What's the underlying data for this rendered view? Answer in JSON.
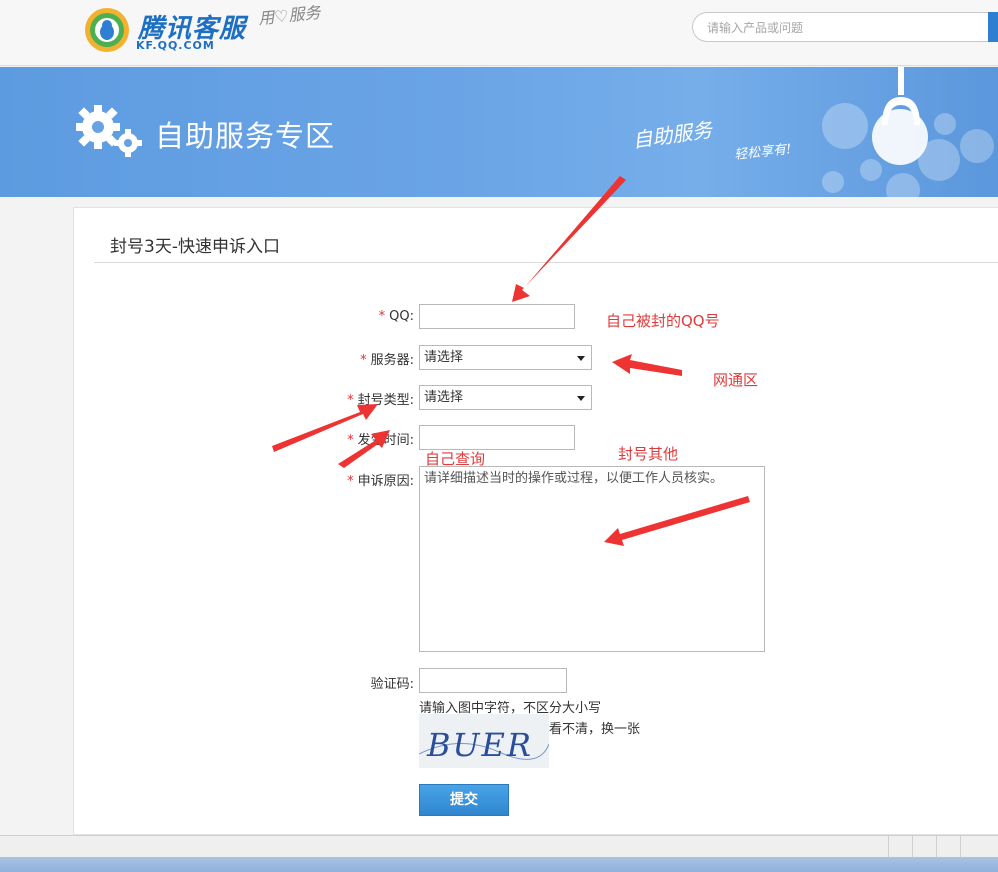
{
  "header": {
    "logo_cn": "腾讯客服",
    "logo_en": "KF.QQ.COM",
    "slogan": "用♡服务",
    "search_placeholder": "请输入产品或问题"
  },
  "banner": {
    "title": "自助服务专区",
    "slogan_main": "自助服务",
    "slogan_sub": "轻松享有!"
  },
  "form": {
    "title": "封号3天-快速申诉入口",
    "required_mark": "*",
    "fields": {
      "qq_label": "QQ:",
      "server_label": "服务器:",
      "server_value": "请选择",
      "ban_type_label": "封号类型:",
      "ban_type_value": "请选择",
      "time_label": "发生时间:",
      "reason_label": "申诉原因:",
      "reason_placeholder": "请详细描述当时的操作或过程，以便工作人员核实。",
      "captcha_label": "验证码:",
      "captcha_hint": "请输入图中字符，不区分大小写",
      "captcha_text": "BUER",
      "captcha_refresh": "看不清，换一张"
    },
    "submit_label": "提交"
  },
  "annotations": {
    "qq_note": "自己被封的QQ号",
    "server_note": "网通区",
    "time_note": "自己查询",
    "type_note": "封号其他"
  },
  "colors": {
    "brand_blue": "#1d6fc4",
    "banner_blue": "#6aa4e6",
    "annotation_red": "#e03b3b",
    "button_blue": "#2f86cf"
  }
}
